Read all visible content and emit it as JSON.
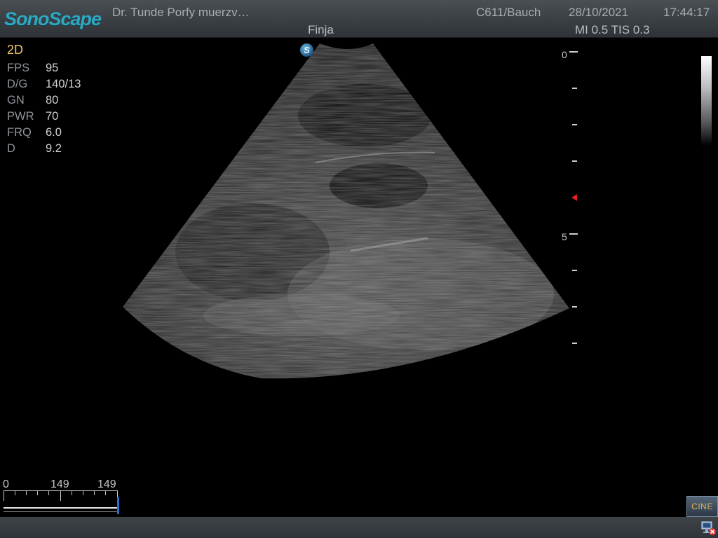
{
  "header": {
    "logo": "SonoScape",
    "doctor": "Dr. Tunde Porfy muerzv…",
    "patient": "Finja",
    "probe_preset": "C611/Bauch",
    "date": "28/10/2021",
    "time": "17:44:17",
    "mi_tis": "MI 0.5 TIS 0.3"
  },
  "params": {
    "mode": "2D",
    "rows": [
      {
        "key": "FPS",
        "value": "95"
      },
      {
        "key": "D/G",
        "value": "140/13"
      },
      {
        "key": "GN",
        "value": "80"
      },
      {
        "key": "PWR",
        "value": "70"
      },
      {
        "key": "FRQ",
        "value": "6.0"
      },
      {
        "key": "D",
        "value": "9.2"
      }
    ]
  },
  "probe_marker": "S",
  "depth_scale": {
    "labels": [
      "0",
      "5"
    ]
  },
  "cine": {
    "start": "0",
    "current": "149",
    "total": "149",
    "button_label": "CINE"
  },
  "icons": {
    "probe_marker": "probe-orientation-icon",
    "focus": "focus-marker-icon",
    "network": "network-disconnected-icon"
  },
  "colors": {
    "brand": "#2fa8c2",
    "mode": "#f2c86a",
    "focus": "#e02020",
    "cine_text": "#e4b45c"
  }
}
